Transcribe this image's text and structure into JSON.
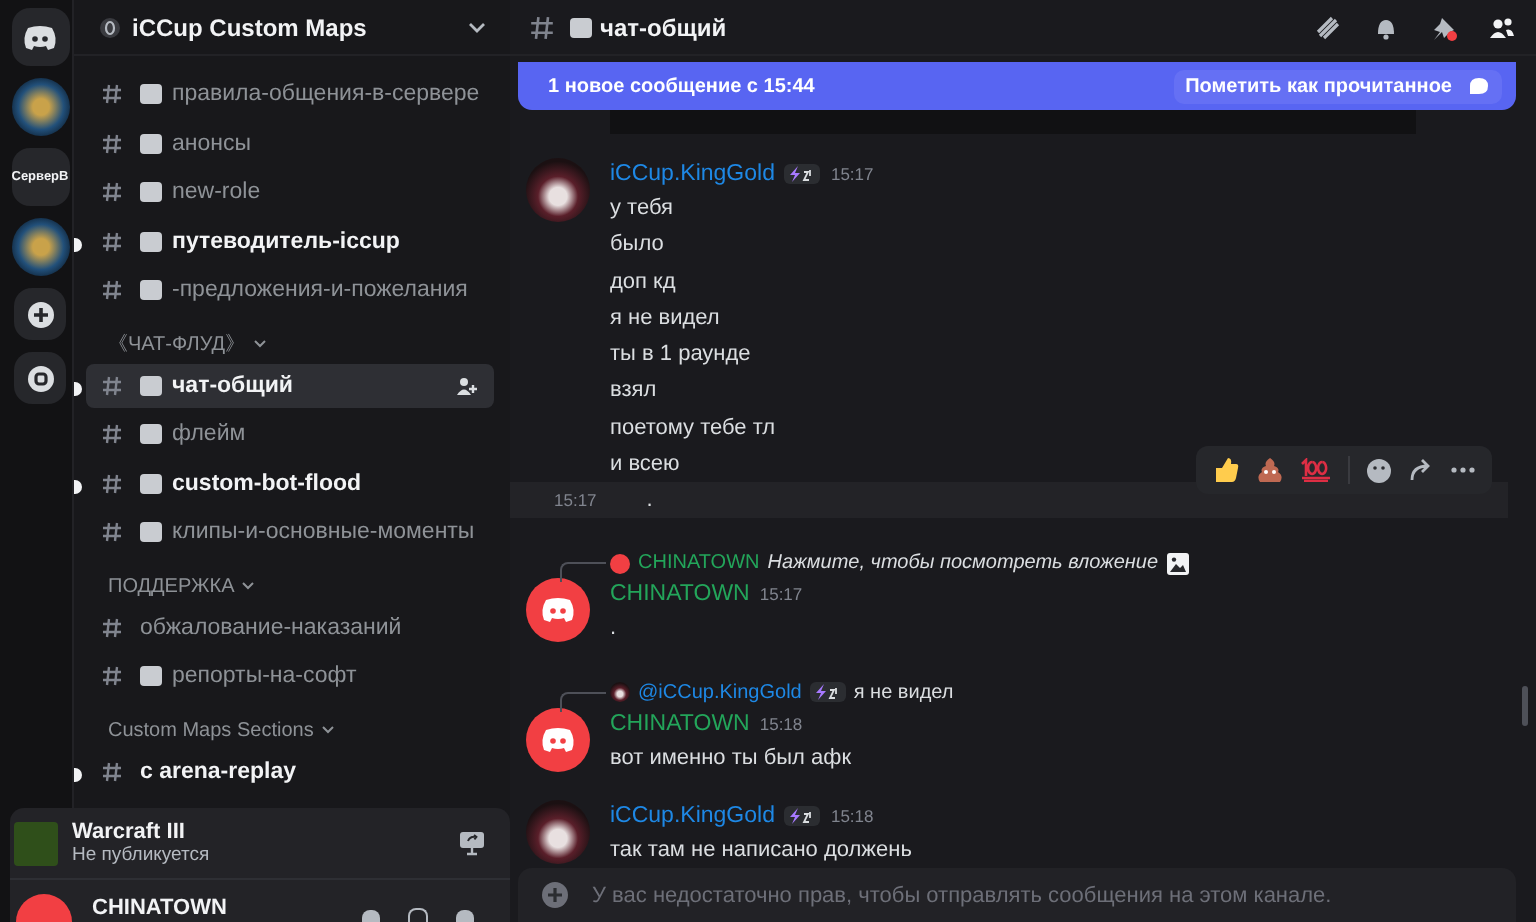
{
  "servers": [
    {
      "kind": "home"
    },
    {
      "kind": "image"
    },
    {
      "kind": "text",
      "label": "СерверВ"
    },
    {
      "kind": "image"
    },
    {
      "kind": "add"
    },
    {
      "kind": "explore"
    }
  ],
  "server_header": {
    "title": "iCCup Custom Maps"
  },
  "sidebar": {
    "items": [
      {
        "kind": "channel",
        "name": "правила-общения-в-сервере",
        "emoji": true,
        "unread": false,
        "selected": false
      },
      {
        "kind": "channel",
        "name": "анонсы",
        "emoji": true,
        "unread": false,
        "selected": false
      },
      {
        "kind": "channel",
        "name": "new-role",
        "emoji": true,
        "unread": false,
        "selected": false
      },
      {
        "kind": "channel",
        "name": "путеводитель-iccup",
        "emoji": true,
        "unread": true,
        "selected": false
      },
      {
        "kind": "channel",
        "name": "-предложения-и-пожелания",
        "emoji": true,
        "unread": false,
        "selected": false
      },
      {
        "kind": "category",
        "name": "《ЧАТ-ФЛУД》"
      },
      {
        "kind": "channel",
        "name": "чат-общий",
        "emoji": true,
        "unread": true,
        "selected": true
      },
      {
        "kind": "channel",
        "name": "флейм",
        "emoji": true,
        "unread": false,
        "selected": false
      },
      {
        "kind": "channel",
        "name": "custom-bot-flood",
        "emoji": true,
        "unread": true,
        "selected": false
      },
      {
        "kind": "channel",
        "name": "клипы-и-основные-моменты",
        "emoji": true,
        "unread": false,
        "selected": false
      },
      {
        "kind": "category",
        "name": "ПОДДЕРЖКА"
      },
      {
        "kind": "channel",
        "name": "обжалование-наказаний",
        "emoji": false,
        "unread": false,
        "selected": false
      },
      {
        "kind": "channel",
        "name": "репорты-на-софт",
        "emoji": true,
        "unread": false,
        "selected": false
      },
      {
        "kind": "category",
        "name": "Custom Maps Sections"
      },
      {
        "kind": "channel",
        "name": "c  arena-replay",
        "emoji": false,
        "unread": true,
        "selected": false
      }
    ]
  },
  "activity": {
    "title": "Warcraft III",
    "subtitle": "Не публикуется"
  },
  "user": {
    "name": "CHINATOWN"
  },
  "channel_header": {
    "name": "чат-общий"
  },
  "new_banner": {
    "text": "1 новое сообщение с 15:44",
    "action": "Пометить как прочитанное"
  },
  "messages": [
    {
      "kind": "attachment"
    },
    {
      "kind": "group",
      "author": "iCCup.KingGold",
      "color": "#1e88e5",
      "avatar": {
        "kind": "photo"
      },
      "badge": true,
      "time": "15:17",
      "lines": [
        "у тебя",
        "было",
        "доп кд",
        "я не видел",
        "ты в 1 раунде",
        "взял",
        "поетому тебе тл",
        "и всею"
      ]
    },
    {
      "kind": "compact",
      "time": "15:17",
      "text": ".",
      "hovered": true
    },
    {
      "kind": "group",
      "author": "CHINATOWN",
      "color": "#23a55a",
      "avatar": {
        "kind": "default"
      },
      "badge": false,
      "time": "15:17",
      "lines": [
        "."
      ],
      "reply": {
        "kind": "attachment",
        "author": "CHINATOWN",
        "color": "#23a55a",
        "avatar": {
          "kind": "default"
        },
        "badge": false,
        "text": "Нажмите, чтобы посмотреть вложение"
      }
    },
    {
      "kind": "group",
      "author": "CHINATOWN",
      "color": "#23a55a",
      "avatar": {
        "kind": "default"
      },
      "badge": false,
      "time": "15:18",
      "lines": [
        "вот именно ты был афк"
      ],
      "reply": {
        "kind": "text",
        "author": "@iCCup.KingGold",
        "color": "#1e88e5",
        "avatar": {
          "kind": "photo"
        },
        "badge": true,
        "text": "я не видел"
      }
    },
    {
      "kind": "group",
      "author": "iCCup.KingGold",
      "color": "#1e88e5",
      "avatar": {
        "kind": "photo"
      },
      "badge": true,
      "time": "15:18",
      "lines": [
        "так там не написано должень"
      ]
    }
  ],
  "composer": {
    "placeholder": "У вас недостаточно прав, чтобы отправлять сообщения на этом канале."
  }
}
